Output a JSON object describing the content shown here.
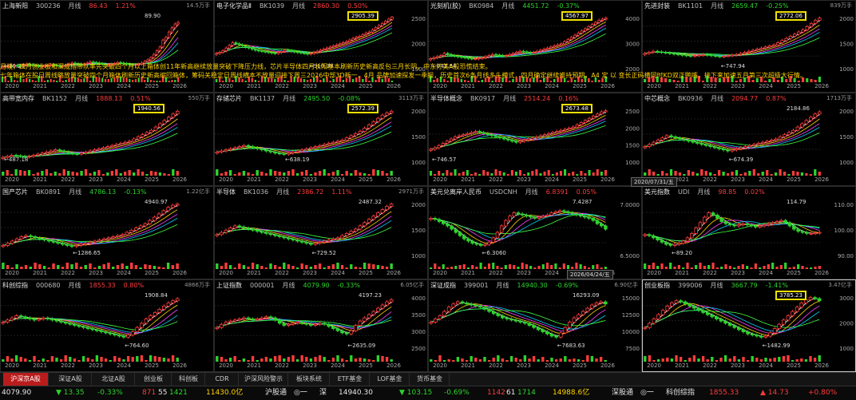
{
  "overlay": {
    "line1": "月线，四月创业板和深成指带队率先突破四个月以上箱体创11年新高继续放量突破下降压力线，芯片半导体四月长阳基本刷新历史新高反包三月长阴，中东打美A股恐慌结束。",
    "line2": "七年箱体在股日周线略放量突破四个月箱体刷新历史新高缩回箱体，筹码关稳定日周线横本不放量迎接下周三2026中部3D新一，4月 品牌加速探发一季报，历史首次6条月线多头模式，四月确定继续推持预期，A4 定 以 变长正码横同时KD双正鸭嘴，接下来加速五月第三次超级大行情。"
  },
  "panels": [
    {
      "name": "上海新阳",
      "code": "300236",
      "period": "月线",
      "price": "86.43",
      "pct": "1.21%",
      "dir": "up",
      "vol": "14.5万手",
      "high": "89.90",
      "low": "20.27",
      "boxed": false,
      "years": [
        "2020",
        "2021",
        "2022",
        "2023",
        "2024",
        "2025",
        "2026"
      ],
      "yticks": [],
      "candles": [
        5,
        6,
        7,
        6,
        8,
        7,
        6,
        9,
        10,
        9,
        8,
        7,
        6,
        6,
        7,
        8,
        9,
        8,
        7,
        6,
        7,
        8,
        10,
        12,
        11,
        10,
        9,
        10,
        12,
        14,
        13,
        12,
        11,
        10,
        9,
        9,
        10,
        11,
        13,
        12,
        11,
        10,
        9,
        8,
        9,
        10,
        12,
        15,
        18,
        22,
        28,
        35,
        42,
        55,
        60,
        70,
        78,
        85,
        88
      ]
    },
    {
      "name": "电子化学品Ⅱ",
      "code": "BK1039",
      "period": "月线",
      "price": "2860.30",
      "pct": "0.50%",
      "dir": "up",
      "vol": "",
      "high": "2905.39",
      "low": "910.39",
      "boxed": true,
      "years": [
        "2020",
        "2021",
        "2022",
        "2023",
        "2024",
        "2025",
        "2026"
      ],
      "yticks": [
        "2500",
        "2000",
        "1500"
      ],
      "candles": [
        30,
        32,
        35,
        40,
        45,
        50,
        48,
        46,
        44,
        42,
        40,
        38,
        36,
        35,
        34,
        33,
        32,
        31,
        30,
        32,
        34,
        36,
        35,
        34,
        33,
        32,
        31,
        30,
        29,
        30,
        32,
        34,
        36,
        38,
        40,
        42,
        44,
        46,
        48,
        50,
        52,
        55,
        58,
        60,
        62,
        65,
        68,
        70,
        74,
        78,
        82,
        86,
        90,
        94,
        98
      ]
    },
    {
      "name": "光刻机(胶)",
      "code": "BK0984",
      "period": "月线",
      "price": "4451.72",
      "pct": "-0.37%",
      "dir": "dn",
      "vol": "",
      "high": "4567.97",
      "low": "943.84",
      "boxed": true,
      "years": [
        "2020",
        "2021",
        "2022",
        "2023",
        "2024",
        "2025",
        "2026"
      ],
      "yticks": [
        "4000",
        "3000",
        "2000"
      ],
      "candles": [
        20,
        22,
        24,
        26,
        30,
        28,
        26,
        25,
        24,
        23,
        22,
        21,
        20,
        20,
        21,
        22,
        24,
        26,
        28,
        27,
        26,
        25,
        26,
        28,
        30,
        32,
        34,
        33,
        32,
        31,
        32,
        34,
        36,
        38,
        40,
        42,
        44,
        46,
        48,
        52,
        56,
        60,
        64,
        68,
        72,
        76,
        80,
        84,
        88,
        92,
        94,
        96
      ]
    },
    {
      "name": "先进封装",
      "code": "BK1101",
      "period": "月线",
      "price": "2659.47",
      "pct": "-0.25%",
      "dir": "dn",
      "vol": "839万手",
      "high": "2772.06",
      "low": "747.94",
      "boxed": true,
      "years": [
        "2020",
        "2021",
        "2022",
        "2023",
        "2024",
        "2025",
        "2026"
      ],
      "yticks": [
        "2000",
        "1500",
        "1000"
      ],
      "candles": [
        30,
        32,
        34,
        33,
        32,
        31,
        30,
        29,
        28,
        27,
        26,
        25,
        26,
        27,
        28,
        27,
        26,
        25,
        24,
        25,
        26,
        27,
        28,
        30,
        32,
        34,
        36,
        38,
        40,
        42,
        44,
        46,
        50,
        54,
        58,
        62,
        66,
        70,
        74,
        80,
        86,
        92,
        96
      ]
    },
    {
      "name": "高带宽内存",
      "code": "BK1152",
      "period": "月线",
      "price": "1888.13",
      "pct": "0.51%",
      "dir": "up",
      "vol": "550万手",
      "high": "1940.56",
      "low": "487.18",
      "boxed": true,
      "years": [
        "2020",
        "2021",
        "2022",
        "2023",
        "2024",
        "2025",
        "2026"
      ],
      "yticks": [],
      "candles": [
        10,
        12,
        14,
        13,
        12,
        11,
        12,
        14,
        16,
        18,
        20,
        22,
        24,
        22,
        20,
        18,
        17,
        16,
        18,
        20,
        22,
        24,
        26,
        28,
        30,
        32,
        34,
        36,
        38,
        40,
        44,
        48,
        52,
        56,
        60,
        66,
        72,
        78,
        84,
        90,
        95
      ]
    },
    {
      "name": "存储芯片",
      "code": "BK1137",
      "period": "月线",
      "price": "2495.50",
      "pct": "-0.08%",
      "dir": "dn",
      "vol": "3113万手",
      "high": "2572.39",
      "low": "638.19",
      "boxed": true,
      "years": [
        "2020",
        "2021",
        "2022",
        "2023",
        "2024",
        "2025",
        "2026"
      ],
      "yticks": [
        "2000",
        "1500",
        "1000"
      ],
      "candles": [
        20,
        22,
        24,
        26,
        28,
        30,
        32,
        30,
        28,
        26,
        24,
        22,
        20,
        18,
        17,
        16,
        18,
        20,
        22,
        24,
        26,
        28,
        30,
        32,
        34,
        36,
        38,
        40,
        42,
        46,
        50,
        54,
        58,
        64,
        70,
        76,
        82,
        88,
        92,
        95
      ]
    },
    {
      "name": "半导体概念",
      "code": "BK0917",
      "period": "月线",
      "price": "2514.24",
      "pct": "0.16%",
      "dir": "up",
      "vol": "",
      "high": "2673.48",
      "low": "746.57",
      "boxed": true,
      "years": [
        "2020",
        "2021",
        "2022",
        "2023",
        "2024",
        "2025",
        "2026"
      ],
      "yticks": [
        "2500",
        "2000",
        "1500",
        "1000"
      ],
      "candles": [
        25,
        28,
        32,
        36,
        40,
        44,
        48,
        50,
        52,
        54,
        56,
        58,
        56,
        54,
        52,
        50,
        48,
        46,
        44,
        42,
        40,
        38,
        40,
        42,
        44,
        46,
        48,
        50,
        52,
        54,
        56,
        58,
        60,
        62,
        64,
        66,
        70,
        74,
        78,
        82,
        86,
        90,
        94,
        96
      ]
    },
    {
      "name": "中芯概念",
      "code": "BK0936",
      "period": "月线",
      "price": "2094.77",
      "pct": "0.87%",
      "dir": "up",
      "vol": "1713万手",
      "high": "2184.86",
      "low": "674.39",
      "boxed": false,
      "years": [
        "2020",
        "2021",
        "2022",
        "2023",
        "2024",
        "2025",
        "2026"
      ],
      "yticks": [
        "2000",
        "1500",
        "1000"
      ],
      "candles": [
        30,
        34,
        38,
        42,
        46,
        50,
        48,
        46,
        44,
        42,
        40,
        38,
        36,
        34,
        32,
        30,
        28,
        26,
        24,
        22,
        24,
        26,
        28,
        30,
        32,
        34,
        36,
        38,
        40,
        42,
        44,
        48,
        52,
        56,
        60,
        66,
        72,
        78,
        84,
        90,
        94
      ]
    },
    {
      "name": "国产芯片",
      "code": "BK0891",
      "period": "月线",
      "price": "4786.13",
      "pct": "-0.13%",
      "dir": "dn",
      "vol": "1.22亿手",
      "high": "4940.97",
      "low": "1286.65",
      "boxed": false,
      "years": [
        "2020",
        "2021",
        "2022",
        "2023",
        "2024",
        "2025",
        "2026"
      ],
      "yticks": [],
      "candles": [
        20,
        24,
        28,
        32,
        36,
        38,
        36,
        34,
        32,
        30,
        28,
        26,
        24,
        22,
        20,
        18,
        20,
        22,
        24,
        26,
        28,
        30,
        32,
        34,
        36,
        38,
        40,
        44,
        48,
        52,
        56,
        60,
        66,
        72,
        78,
        84,
        90,
        94,
        96
      ]
    },
    {
      "name": "半导体",
      "code": "BK1036",
      "period": "月线",
      "price": "2386.72",
      "pct": "1.11%",
      "dir": "up",
      "vol": "2971万手",
      "high": "2487.32",
      "low": "729.52",
      "boxed": false,
      "years": [
        "2020",
        "2021",
        "2022",
        "2023",
        "2024",
        "2025",
        "2026"
      ],
      "yticks": [
        "2000",
        "1500",
        "1000"
      ],
      "candles": [
        40,
        44,
        48,
        52,
        56,
        54,
        52,
        50,
        48,
        46,
        44,
        42,
        40,
        38,
        36,
        34,
        32,
        30,
        28,
        26,
        24,
        22,
        24,
        26,
        28,
        30,
        32,
        34,
        38,
        42,
        46,
        50,
        56,
        62,
        68,
        74,
        80,
        86,
        92,
        96
      ]
    },
    {
      "name": "美元兑离岸人民币",
      "code": "USDCNH",
      "period": "月线",
      "price": "6.8391",
      "pct": "0.05%",
      "dir": "up",
      "vol": "",
      "high": "7.4287",
      "low": "6.3060",
      "boxed": false,
      "years": [
        "2020",
        "2021",
        "2022",
        "2023",
        "2024",
        "2025",
        "2026"
      ],
      "yticks": [
        "7.0000",
        "6.5000"
      ],
      "candles": [
        70,
        68,
        64,
        60,
        56,
        50,
        44,
        38,
        32,
        28,
        24,
        22,
        20,
        22,
        26,
        34,
        44,
        56,
        66,
        74,
        80,
        78,
        76,
        74,
        72,
        70,
        72,
        74,
        76,
        80,
        82,
        84,
        82,
        80,
        78,
        76,
        74,
        72,
        70,
        66,
        60,
        56,
        50
      ]
    },
    {
      "name": "美元指数",
      "code": "UDI",
      "period": "月线",
      "price": "98.85",
      "pct": "0.02%",
      "dir": "up",
      "vol": "",
      "high": "114.79",
      "low": "89.20",
      "boxed": false,
      "years": [
        "2020",
        "2021",
        "2022",
        "2023",
        "2024",
        "2025",
        "2026"
      ],
      "yticks": [
        "110.00",
        "100.00",
        "90.00"
      ],
      "candles": [
        40,
        38,
        34,
        30,
        26,
        22,
        20,
        22,
        24,
        28,
        34,
        42,
        52,
        62,
        72,
        80,
        76,
        70,
        64,
        60,
        58,
        56,
        58,
        60,
        58,
        56,
        54,
        56,
        58,
        60,
        62,
        64,
        66,
        62,
        56,
        50,
        46,
        44,
        42,
        42,
        43,
        44
      ]
    },
    {
      "name": "科创综指",
      "code": "000680",
      "period": "月线",
      "price": "1855.33",
      "pct": "0.80%",
      "dir": "up",
      "vol": "4866万手",
      "high": "1908.84",
      "low": "764.60",
      "boxed": false,
      "years": [
        "2020",
        "2021",
        "2022",
        "2023",
        "2024",
        "2025",
        "2026"
      ],
      "yticks": [],
      "candles": [
        50,
        54,
        58,
        62,
        60,
        58,
        56,
        54,
        56,
        58,
        56,
        54,
        52,
        50,
        48,
        46,
        44,
        42,
        40,
        38,
        36,
        34,
        32,
        30,
        28,
        26,
        24,
        22,
        26,
        32,
        40,
        48,
        56,
        62,
        68,
        74,
        80,
        86,
        90,
        94
      ]
    },
    {
      "name": "上证指数",
      "code": "000001",
      "period": "月线",
      "price": "4079.90",
      "pct": "-0.33%",
      "dir": "dn",
      "vol": "6.05亿手",
      "high": "4197.23",
      "low": "2635.09",
      "boxed": false,
      "years": [
        "2020",
        "2021",
        "2022",
        "2023",
        "2024",
        "2025",
        "2026"
      ],
      "yticks": [
        "4000",
        "3500",
        "3000",
        "2500"
      ],
      "candles": [
        40,
        46,
        50,
        52,
        54,
        56,
        58,
        56,
        54,
        56,
        58,
        60,
        58,
        54,
        48,
        44,
        46,
        48,
        50,
        48,
        46,
        44,
        46,
        48,
        46,
        42,
        38,
        34,
        30,
        28,
        34,
        44,
        52,
        58,
        64,
        70,
        76,
        82,
        88,
        92
      ]
    },
    {
      "name": "深证成指",
      "code": "399001",
      "period": "月线",
      "price": "14940.30",
      "pct": "-0.69%",
      "dir": "dn",
      "vol": "6.90亿手",
      "high": "16293.09",
      "low": "7683.63",
      "boxed": false,
      "years": [
        "2020",
        "2021",
        "2022",
        "2023",
        "2024",
        "2025",
        "2026"
      ],
      "yticks": [
        "15000",
        "12500",
        "10000",
        "7500"
      ],
      "candles": [
        50,
        56,
        62,
        70,
        78,
        84,
        88,
        86,
        84,
        82,
        80,
        78,
        74,
        70,
        66,
        62,
        58,
        56,
        54,
        52,
        50,
        48,
        44,
        40,
        36,
        32,
        28,
        24,
        22,
        30,
        40,
        50,
        58,
        64,
        70,
        76,
        82,
        86,
        88,
        84
      ]
    },
    {
      "name": "创业板指",
      "code": "399006",
      "period": "月线",
      "price": "3667.79",
      "pct": "-1.41%",
      "dir": "dn",
      "vol": "3.47亿手",
      "high": "3785.23",
      "low": "1482.99",
      "boxed": true,
      "years": [
        "2020",
        "2021",
        "2022",
        "2023",
        "2024",
        "2025",
        "2026"
      ],
      "yticks": [
        "3000",
        "2000",
        "1000"
      ],
      "candles": [
        40,
        48,
        56,
        64,
        72,
        80,
        86,
        90,
        88,
        84,
        80,
        76,
        72,
        68,
        64,
        60,
        56,
        52,
        48,
        44,
        40,
        36,
        32,
        28,
        26,
        24,
        22,
        24,
        30,
        38,
        46,
        54,
        62,
        70,
        78,
        86,
        92,
        96,
        94,
        90
      ]
    }
  ],
  "date_tags": [
    "2020/07/31/五",
    "2026/04/24/五"
  ],
  "tabs": [
    "沪深京A股",
    "深证A股",
    "北证A股",
    "创业板",
    "科创板",
    "CDR",
    "沪深风险警示",
    "板块系统",
    "ETF基金",
    "LOF基金",
    "货币基金"
  ],
  "status": {
    "f1": "4079.90",
    "f2": "▼ 13.35",
    "f3": "-0.33%",
    "f4": "871",
    "f5": "55",
    "f6": "1421",
    "f7": "11430.0亿",
    "f8": "沪股通",
    "f9": "◎一",
    "f10": "深",
    "f11": "14940.30",
    "f12": "▼ 103.15",
    "f13": "-0.69%",
    "f14": "1142",
    "f15": "61",
    "f16": "1714",
    "f17": "14988.6亿",
    "f18": "深股通",
    "f19": "◎一",
    "f20": "科创综指",
    "f21": "1855.33",
    "f22": "▲ 14.73",
    "f23": "+0.80%"
  },
  "colors": {
    "up": "#ff3c3c",
    "down": "#2dd42d",
    "accent_tab": "#b91c1c",
    "highlight_box": "#f0e000"
  }
}
